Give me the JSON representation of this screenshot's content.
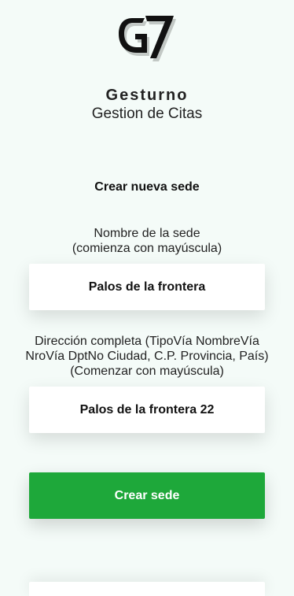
{
  "branding": {
    "logo_icon": "g7-logo-icon",
    "app_name": "Gesturno",
    "app_subtitle": "Gestion de Citas"
  },
  "form": {
    "title": "Crear nueva sede",
    "name_label_line1": "Nombre de la sede",
    "name_label_line2": "(comienza con mayúscula)",
    "name_value": "Palos de la frontera",
    "address_label": "Dirección completa (TipoVía NombreVía NroVía DptNo Ciudad, C.P. Provincia, País) (Comenzar con mayúscula)",
    "address_value": "Palos de la frontera 22",
    "submit_label": "Crear sede"
  },
  "colors": {
    "background": "#f4fbf8",
    "accent": "#1ea83a",
    "field_background": "#ffffff"
  }
}
